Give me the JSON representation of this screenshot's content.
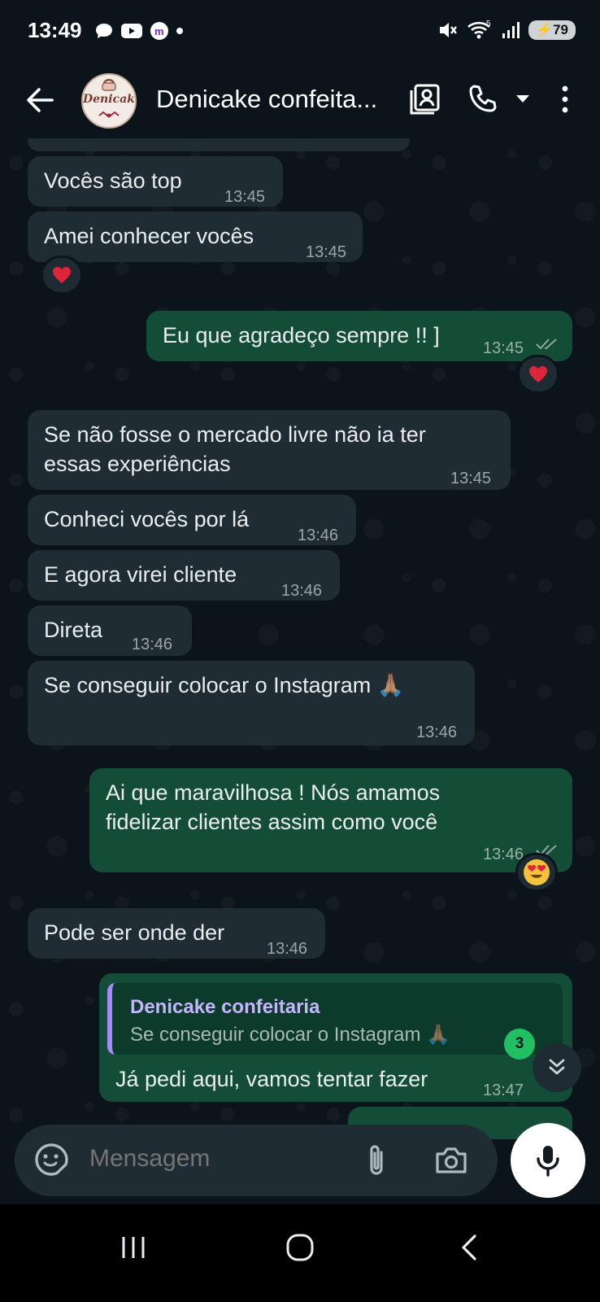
{
  "status_bar": {
    "time": "13:49",
    "battery": "79"
  },
  "header": {
    "title": "Denicake confeita...",
    "avatar_text": "Denicake"
  },
  "messages": [
    {
      "text": "Vocês são top",
      "time": "13:45"
    },
    {
      "text": "Amei conhecer vocês",
      "time": "13:45",
      "reaction": "heart"
    },
    {
      "text": "Eu que agradeço sempre !! ]",
      "time": "13:45",
      "reaction": "heart"
    },
    {
      "text": "Se não fosse o mercado livre não ia ter\nessas experiências",
      "time": "13:45"
    },
    {
      "text": "Conheci vocês por lá",
      "time": "13:46"
    },
    {
      "text": "E agora virei cliente",
      "time": "13:46"
    },
    {
      "text": "Direta",
      "time": "13:46"
    },
    {
      "text": "Se conseguir colocar o Instagram 🙏🏽",
      "time": "13:46"
    },
    {
      "text": "Ai que maravilhosa ! Nós amamos\nfidelizar clientes assim como você",
      "time": "13:46",
      "reaction": "heart-eyes"
    },
    {
      "text": "Pode ser onde der",
      "time": "13:46"
    },
    {
      "text": "Já pedi aqui, vamos tentar fazer",
      "time": "13:47",
      "quote": {
        "name": "Denicake confeitaria",
        "text": "Se conseguir colocar o Instagram 🙏🏽"
      }
    }
  ],
  "unread_count": "3",
  "composer": {
    "placeholder": "Mensagem"
  },
  "colors": {
    "incoming": "#202c33",
    "outgoing": "#144d37",
    "background": "#0b141a",
    "badge": "#21c063"
  }
}
